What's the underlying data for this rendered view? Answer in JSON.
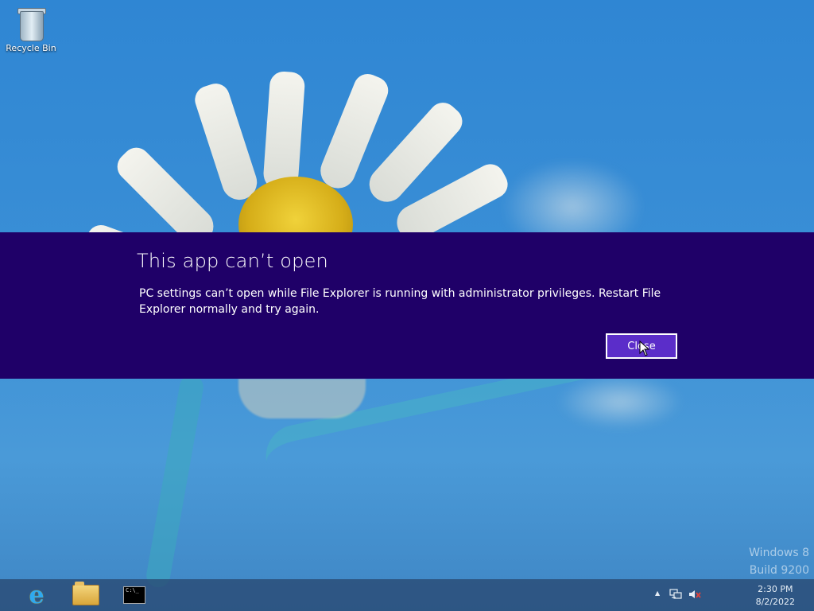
{
  "desktop": {
    "icons": [
      {
        "label": "Recycle Bin",
        "icon": "recycle-bin-icon"
      }
    ]
  },
  "dialog": {
    "title": "This app can’t open",
    "message": "PC settings can’t open while File Explorer is running with administrator privileges. Restart File Explorer normally and try again.",
    "close_label": "Close",
    "background": "#1f0068",
    "button_color": "#5b2dc9"
  },
  "watermark": {
    "line1": "Windows 8",
    "line2": "Build 9200"
  },
  "taskbar": {
    "pinned": [
      {
        "name": "Internet Explorer",
        "icon": "internet-explorer-icon"
      },
      {
        "name": "File Explorer",
        "icon": "file-explorer-icon"
      },
      {
        "name": "Command Prompt",
        "icon": "command-prompt-icon"
      }
    ],
    "cmd_glyph": "C:\\_",
    "tray": {
      "show_hidden": "▲",
      "time": "2:30 PM",
      "date": "8/2/2022"
    }
  }
}
